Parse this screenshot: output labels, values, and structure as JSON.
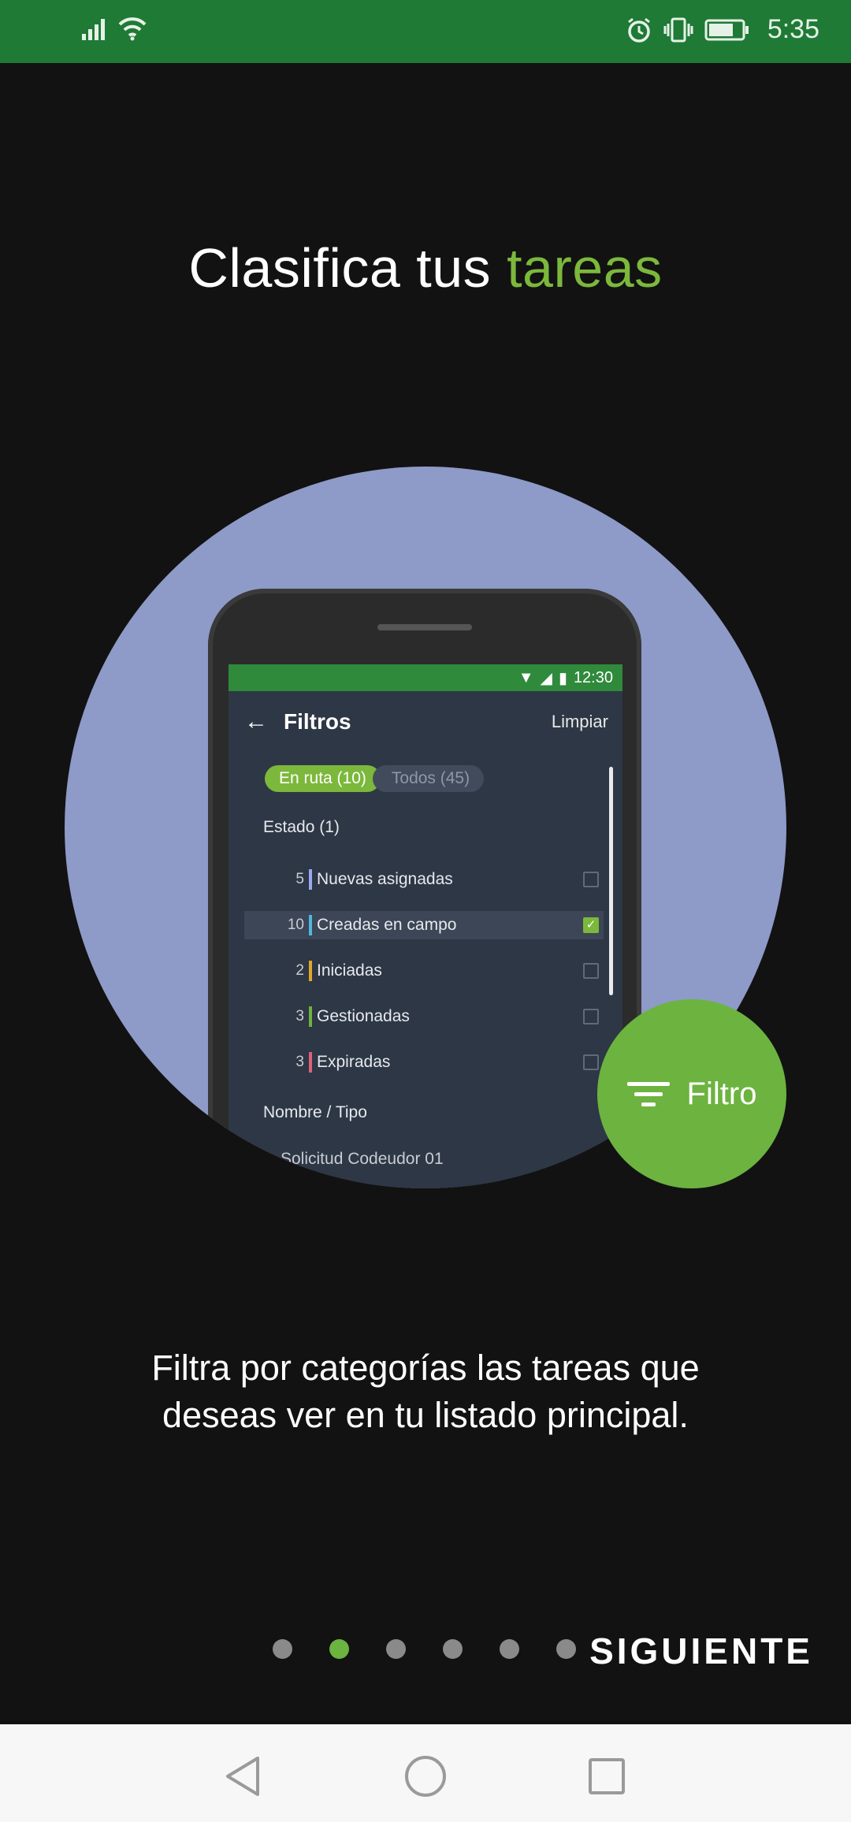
{
  "status_bar": {
    "time": "5:35",
    "icons": [
      "signal-icon",
      "wifi-icon",
      "alarm-icon",
      "vibrate-icon",
      "battery-icon"
    ]
  },
  "onboarding": {
    "title_prefix": "Clasifica tus",
    "title_accent": "tareas",
    "description_line1": "Filtra por categorías las tareas que",
    "description_line2": "deseas ver en tu listado principal.",
    "fab_label": "Filtro",
    "next_label": "SIGUIENTE",
    "page_count": 6,
    "active_page": 2
  },
  "mockup": {
    "status_time": "12:30",
    "screen_title": "Filtros",
    "clear_label": "Limpiar",
    "chips": [
      {
        "label": "En ruta (10)",
        "active": true
      },
      {
        "label": "Todos (45)",
        "active": false
      }
    ],
    "section_estado": "Estado (1)",
    "rows": [
      {
        "count": "5",
        "label": "Nuevas asignadas",
        "color": "#9aa8f0",
        "checked": false
      },
      {
        "count": "10",
        "label": "Creadas en campo",
        "color": "#4fb7e0",
        "checked": true
      },
      {
        "count": "2",
        "label": "Iniciadas",
        "color": "#e0a829",
        "checked": false
      },
      {
        "count": "3",
        "label": "Gestionadas",
        "color": "#6db33f",
        "checked": false
      },
      {
        "count": "3",
        "label": "Expiradas",
        "color": "#e0607a",
        "checked": false
      }
    ],
    "section_tipo": "Nombre / Tipo",
    "partial_row": "Solicitud Codeudor 01"
  },
  "colors": {
    "accent": "#7cb83b",
    "status_bar": "#1e7a34",
    "background": "#121212",
    "circle": "#8e9ac7"
  }
}
